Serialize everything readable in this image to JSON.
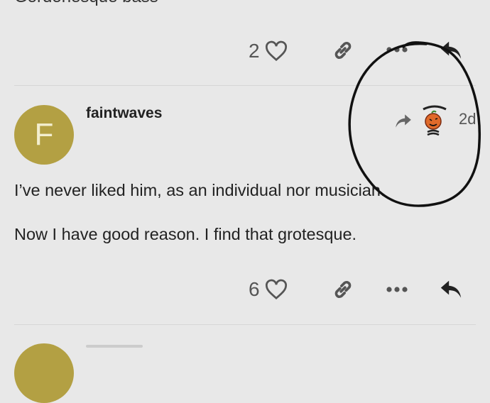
{
  "previous_post": {
    "text_fragment": "Gordonesque bass",
    "like_count": "2"
  },
  "post": {
    "username": "faintwaves",
    "avatar_letter": "F",
    "date": "2d",
    "body_lines": [
      "I’ve never liked him, as an individual nor musician.",
      "Now I have good reason. I find that grotesque."
    ],
    "like_count": "6"
  },
  "colors": {
    "background": "#e8e8e8",
    "avatar": "#b3a043",
    "icon": "#555555"
  },
  "icons": [
    "heart-icon",
    "link-icon",
    "more-icon",
    "reply-icon",
    "share-arrow-icon",
    "sticker-image"
  ]
}
